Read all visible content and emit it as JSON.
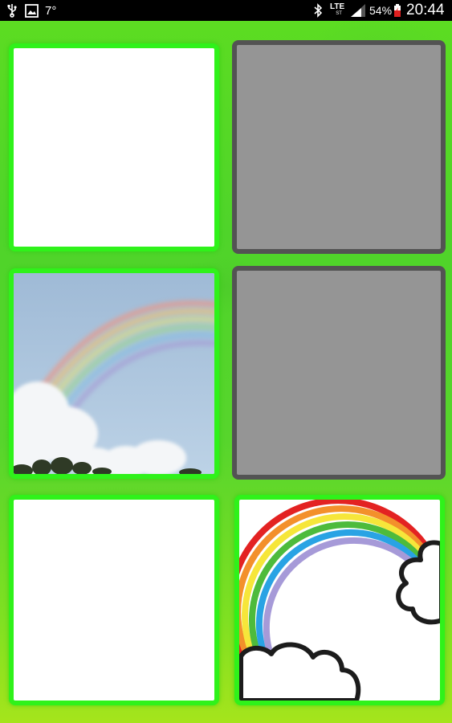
{
  "status_bar": {
    "temperature": "7°",
    "network": "LTE",
    "network_sub": "ST",
    "battery": "54%",
    "time": "20:44"
  },
  "board": {
    "cards": [
      {
        "id": 1,
        "state": "face-up",
        "image": "blank"
      },
      {
        "id": 2,
        "state": "face-down",
        "image": "hidden"
      },
      {
        "id": 3,
        "state": "face-up",
        "image": "rainbow-photo"
      },
      {
        "id": 4,
        "state": "face-down",
        "image": "hidden"
      },
      {
        "id": 5,
        "state": "face-up",
        "image": "blank"
      },
      {
        "id": 6,
        "state": "face-up",
        "image": "rainbow-cartoon"
      }
    ]
  },
  "colors": {
    "background": "#56d82a",
    "card_up_border": "#2ff21a",
    "card_down_fill": "#959595",
    "card_down_border": "#535353"
  }
}
